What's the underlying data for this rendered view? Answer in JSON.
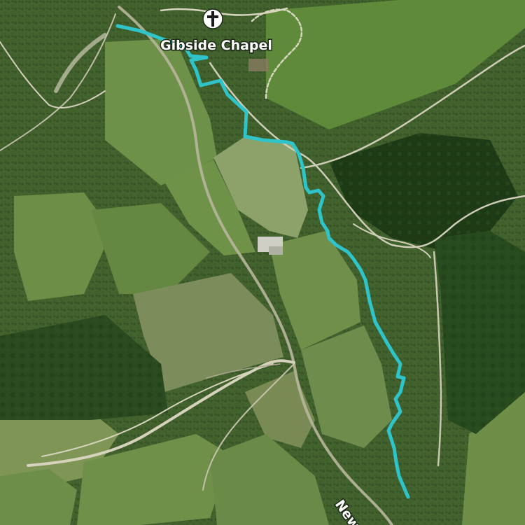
{
  "map": {
    "view": "satellite",
    "route": {
      "color": "#2ec4c9"
    },
    "poi": {
      "label": "Gibside Chapel",
      "icon": "chapel-cross-icon"
    },
    "road_label": "New"
  }
}
